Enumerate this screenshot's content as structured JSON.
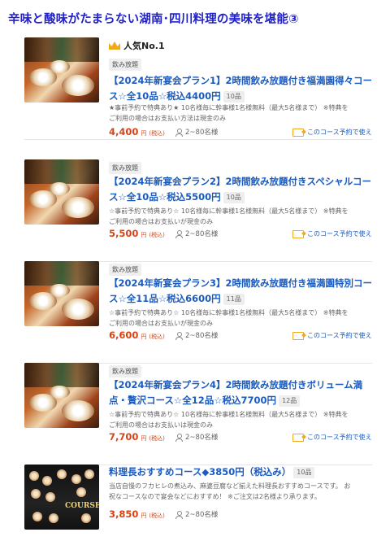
{
  "page": {
    "title": "辛味と酸味がたまらない湖南･四川料理の美味を堪能③"
  },
  "labels": {
    "tax": "(税込)",
    "reserve": "このコース予約で使え"
  },
  "courses": [
    {
      "rank": "人気No.1",
      "category": "飲み放題",
      "name": "【2024年新宴会プラン1】2時間飲み放題付き福満園得々コース☆全10品☆税込4400円",
      "count": "10品",
      "note1": "★事前予約で特典あり★ 10名様毎に幹事様1名様無料（最大5名様まで） ※特典を",
      "note2": "ご利用の場合はお支払い方法は現金のみ",
      "price": "4,400",
      "price_unit": "円",
      "people": "2~80名様"
    },
    {
      "category": "飲み放題",
      "name": "【2024年新宴会プラン2】2時間飲み放題付きスペシャルコース☆全10品☆税込5500円",
      "count": "10品",
      "note1": "☆事前予約で特典あり☆ 10名様毎に幹事様1名様無料（最大5名様まで） ※特典を",
      "note2": "ご利用の場合はお支払いが現金のみ",
      "price": "5,500",
      "price_unit": "円",
      "people": "2~80名様"
    },
    {
      "category": "飲み放題",
      "name": "【2024年新宴会プラン3】2時間飲み放題付き福満園特別コース☆全11品☆税込6600円",
      "count": "11品",
      "note1": "☆事前予約で特典あり☆ 10名様毎に幹事様1名様無料（最大5名様まで） ※特典を",
      "note2": "ご利用の場合はお支払いが現金のみ",
      "price": "6,600",
      "price_unit": "円",
      "people": "2~80名様"
    },
    {
      "category": "飲み放題",
      "name": "【2024年新宴会プラン4】2時間飲み放題付きボリューム満点・贅沢コース☆全12品☆税込7700円",
      "count": "12品",
      "note1": "☆事前予約で特典あり☆ 10名様毎に幹事様1名様無料（最大5名様まで） ※特典を",
      "note2": "ご利用の場合はお支払いは現金のみ",
      "price": "7,700",
      "price_unit": "円",
      "people": "2~80名様"
    },
    {
      "name": "料理長おすすめコース◆3850円（税込み）",
      "count": "10品",
      "note1": "当店自慢のフカヒレの煮込み、麻婆豆腐など揃えた料理長おすすめコースです。 お",
      "note2": "祝なコースなので宴会などにおすすめ！ ※ご注文は2名様より承ります。",
      "price": "3,850",
      "price_unit": "円",
      "people": "2~80名様",
      "image_text": "COURSE"
    }
  ]
}
